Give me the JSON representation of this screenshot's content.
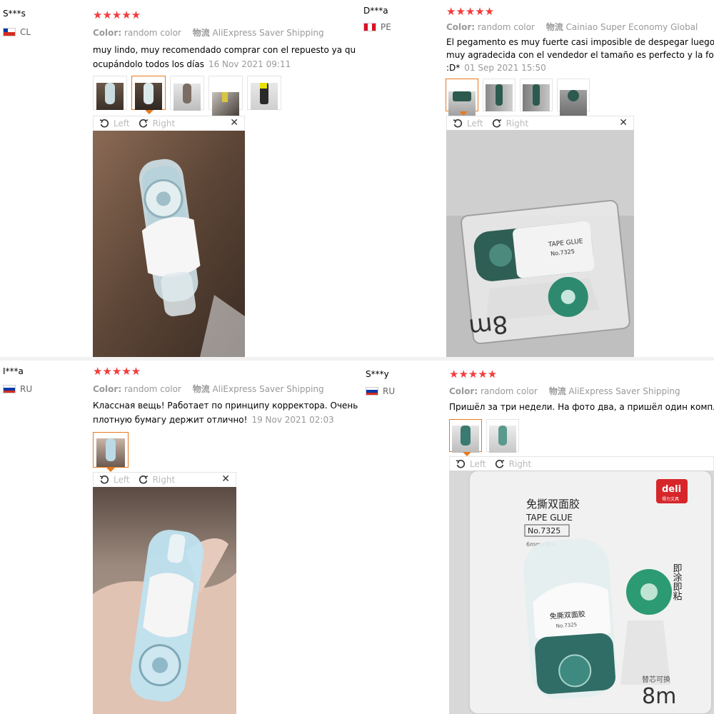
{
  "reviews": [
    {
      "user": "S***s",
      "country": "CL",
      "stars": "★★★★★",
      "color_label": "Color:",
      "color_value": "random color",
      "shipping_label": "物流",
      "shipping_value": "AliExpress Saver Shipping",
      "text_line1": "muy lindo, muy recomendado comprar con el repuesto ya qu",
      "text_line2": "ocupándolo todos los días",
      "date": "16 Nov 2021 09:11",
      "viewer_left": "Left",
      "viewer_right": "Right"
    },
    {
      "user": "D***a",
      "country": "PE",
      "stars": "★★★★★",
      "color_label": "Color:",
      "color_value": "random color",
      "shipping_label": "物流",
      "shipping_value": "Cainiao Super Economy Global",
      "text_line1": "El pegamento es muy fuerte casi imposible de despegar luego de ha",
      "text_line2": "muy agradecida con el vendedor el tamaño es perfecto y la forma fa",
      "text_line3": ":D*",
      "date": "01 Sep 2021 15:50",
      "viewer_left": "Left",
      "viewer_right": "Right",
      "photo_text1": "TAPE GLUE",
      "photo_text2": "No.7325",
      "photo_text3": "8m"
    },
    {
      "user": "I***a",
      "country": "RU",
      "stars": "★★★★★",
      "color_label": "Color:",
      "color_value": "random color",
      "shipping_label": "物流",
      "shipping_value": "AliExpress Saver Shipping",
      "text_line1": "Классная вещь! Работает по принципу корректора. Очень",
      "text_line2": "плотную бумагу держит отлично!",
      "date": "19 Nov 2021 02:03",
      "viewer_left": "Left",
      "viewer_right": "Right"
    },
    {
      "user": "S***y",
      "country": "RU",
      "stars": "★★★★★",
      "color_label": "Color:",
      "color_value": "random color",
      "shipping_label": "物流",
      "shipping_value": "AliExpress Saver Shipping",
      "text_line1": "Пришёл за три недели. На фото два, а пришёл один комплект. I",
      "viewer_left": "Left",
      "viewer_right": "Right",
      "photo_brand": "deli",
      "photo_brand_sub": "得力文具",
      "photo_title_cn": "免撕双面胶",
      "photo_title_en": "TAPE GLUE",
      "photo_model": "No.7325",
      "photo_size": "6mm×8m",
      "photo_side_cn": "即涂即粘",
      "photo_label_cn": "免撕双面胶",
      "photo_label_no": "No.7325",
      "photo_refill": "替芯可换",
      "photo_length": "8m"
    }
  ],
  "colors": {
    "star": "#f23c3c",
    "accent_border": "#e8791d",
    "meta": "#999999"
  }
}
